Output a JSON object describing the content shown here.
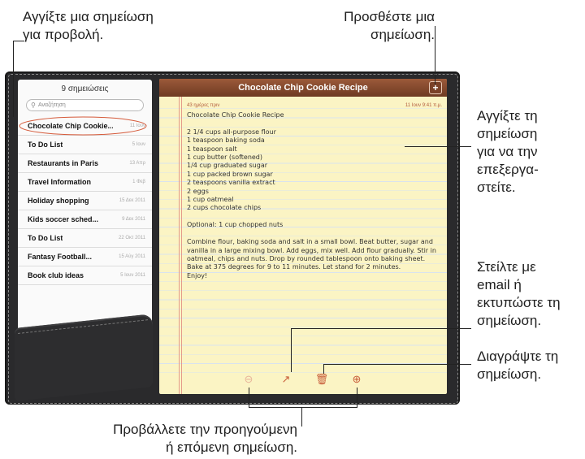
{
  "callouts": {
    "tap_note": [
      "Αγγίξτε μια σημείωση",
      "για προβολή."
    ],
    "add_note": [
      "Προσθέστε μια",
      "σημείωση."
    ],
    "edit_note": [
      "Αγγίξτε τη",
      "σημείωση",
      "για να την",
      "επεξεργα-",
      "στείτε."
    ],
    "send_note": [
      "Στείλτε με",
      "email ή",
      "εκτυπώστε τη",
      "σημείωση."
    ],
    "delete_note": [
      "Διαγράψτε τη",
      "σημείωση."
    ],
    "prev_next": [
      "Προβάλλετε την προηγούμενη",
      "ή επόμενη σημείωση."
    ]
  },
  "sidebar": {
    "title": "9 σημειώσεις",
    "search_placeholder": "Αναζήτηση",
    "notes": [
      {
        "title": "Chocolate Chip Cookie...",
        "date": "11 Ιουν"
      },
      {
        "title": "To Do List",
        "date": "5 Ιουν"
      },
      {
        "title": "Restaurants in Paris",
        "date": "13 Απρ"
      },
      {
        "title": "Travel Information",
        "date": "1 Φεβ"
      },
      {
        "title": "Holiday shopping",
        "date": "15 Δεκ 2011"
      },
      {
        "title": "Kids soccer sched...",
        "date": "9 Δεκ 2011"
      },
      {
        "title": "To Do List",
        "date": "22 Οκτ 2011"
      },
      {
        "title": "Fantasy Football...",
        "date": "15 Αύγ 2011"
      },
      {
        "title": "Book club ideas",
        "date": "5 Ιουν 2011"
      }
    ]
  },
  "note": {
    "header_title": "Chocolate Chip Cookie Recipe",
    "age": "43 ημέρες πριν",
    "timestamp": "11 Ιουν 9:41 π.μ.",
    "body": "Chocolate Chip Cookie Recipe\n\n2 1/4 cups all-purpose flour\n1 teaspoon baking soda\n1 teaspoon salt\n1 cup butter (softened)\n1/4 cup graduated sugar\n1 cup packed brown sugar\n2 teaspoons vanilla extract\n2 eggs\n1 cup oatmeal\n2 cups chocolate chips\n\nOptional: 1 cup chopped nuts\n\nCombine flour, baking soda and salt in a small bowl. Beat butter, sugar and vanilla in a large mixing bowl. Add eggs, mix well. Add flour gradually. Stir in oatmeal, chips and nuts. Drop by rounded tablespoon onto baking sheet. Bake at 375 degrees for 9 to 11 minutes. Let stand for 2 minutes.\nEnjoy!"
  },
  "icons": {
    "add": "+",
    "search": "⚲",
    "prev": "⊖",
    "share": "↗",
    "trash": "🗑",
    "next": "⊕"
  },
  "colors": {
    "header": "#7a4128",
    "paper": "#fbf4c4",
    "accent": "#c85d3a"
  }
}
